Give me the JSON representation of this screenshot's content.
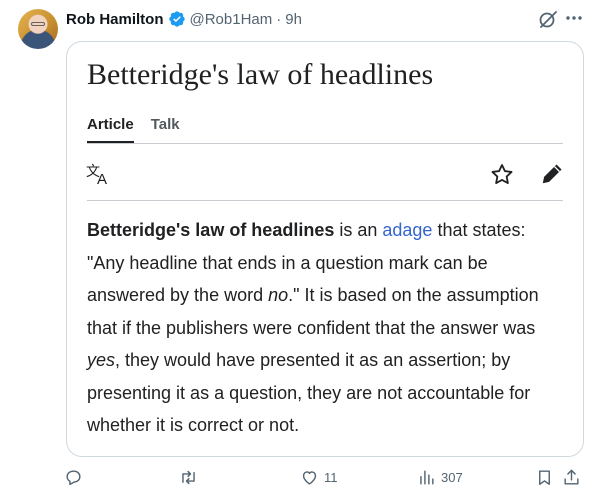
{
  "tweet": {
    "author_name": "Rob Hamilton",
    "handle": "@Rob1Ham",
    "separator": "·",
    "time": "9h",
    "avatar_icon": "avatar-photo",
    "verified_color": "#1d9bf0"
  },
  "card": {
    "title": "Betteridge's law of headlines",
    "tabs": [
      {
        "label": "Article",
        "active": true
      },
      {
        "label": "Talk",
        "active": false
      }
    ],
    "article": {
      "bold_term": "Betteridge's law of headlines",
      "text_1": " is an ",
      "link": "adage",
      "text_2": " that states: \"Any headline that ends in a question mark can be answered by the word ",
      "italic_no": "no",
      "text_3": ".\" It is based on the assumption that if the publishers were confident that the answer was ",
      "italic_yes": "yes",
      "text_4": ", they would have presented it as an assertion; by presenting it as a question, they are not accountable for whether it is correct or not."
    },
    "link_color": "#3366cc"
  },
  "actions": {
    "reply_count": "",
    "retweet_count": "",
    "like_count": "11",
    "views_count": "307",
    "icon_color": "#536471"
  }
}
